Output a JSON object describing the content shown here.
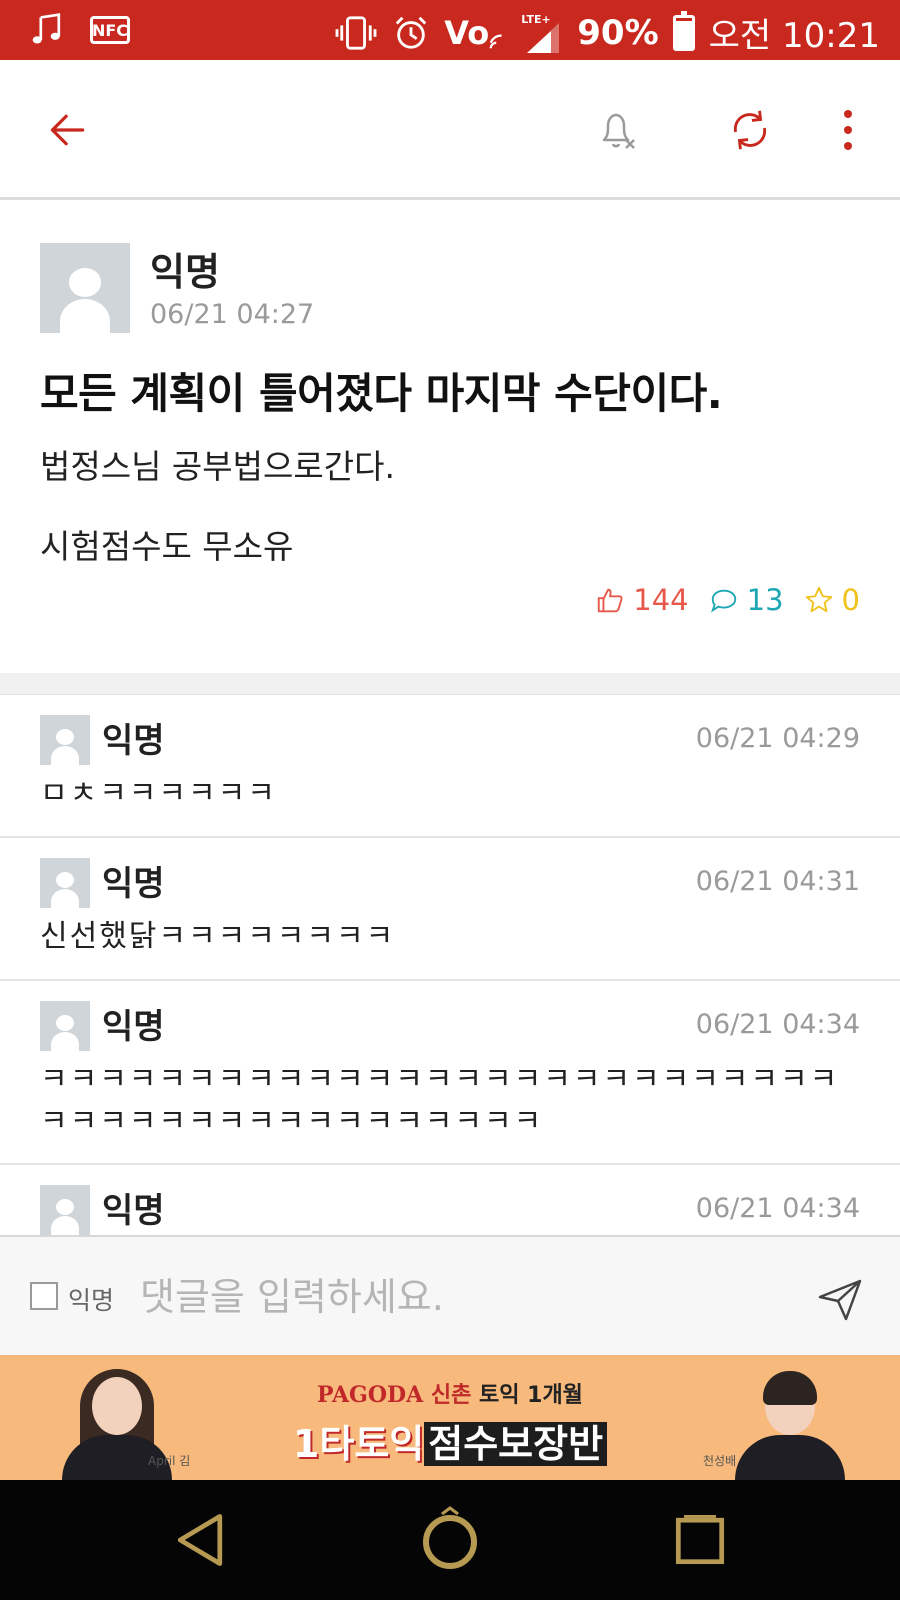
{
  "status_bar": {
    "battery_percent": "90%",
    "battery_level": 0.9,
    "time": "오전 10:21",
    "left_icons": [
      "music-note-icon",
      "nfc-icon"
    ],
    "right_icons": [
      "vibrate-icon",
      "alarm-icon",
      "volte-icon",
      "lte-signal-icon",
      "battery-icon"
    ],
    "nfc_label": "NFC",
    "volte_label": "Vo",
    "lte_label": "LTE+",
    "accent_color": "#c8281e"
  },
  "toolbar": {
    "icons": [
      "back-arrow-icon",
      "notification-off-icon",
      "refresh-icon",
      "more-vertical-icon"
    ]
  },
  "post": {
    "author": "익명",
    "time": "06/21 04:27",
    "title": "모든 계획이 틀어졌다 마지막 수단이다.",
    "body": [
      "법정스님 공부법으로간다.",
      "시험점수도 무소유"
    ],
    "likes": "144",
    "comments": "13",
    "scraps": "0",
    "colors": {
      "likes": "#e8584a",
      "comments": "#1fa7b4",
      "scraps": "#f1c21b"
    }
  },
  "comments": [
    {
      "author": "익명",
      "time": "06/21 04:29",
      "text": "ㅁㅊㅋㅋㅋㅋㅋㅋ"
    },
    {
      "author": "익명",
      "time": "06/21 04:31",
      "text": "신선했닭ㅋㅋㅋㅋㅋㅋㅋㅋ"
    },
    {
      "author": "익명",
      "time": "06/21 04:34",
      "text": "ㅋㅋㅋㅋㅋㅋㅋㅋㅋㅋㅋㅋㅋㅋㅋㅋㅋㅋㅋㅋㅋㅋㅋㅋㅋㅋㅋㅋㅋㅋㅋㅋㅋㅋㅋㅋㅋㅋㅋㅋㅋㅋㅋㅋ"
    },
    {
      "author": "익명",
      "time": "06/21 04:34",
      "text": ""
    }
  ],
  "input_bar": {
    "anonymous_label": "익명",
    "anonymous_checked": false,
    "placeholder": "댓글을 입력하세요."
  },
  "ad": {
    "brand": "PAGODA",
    "subtitle_location": "신촌",
    "subtitle_course": "토익 1개월",
    "headline_part1": "1타토익",
    "headline_part2": "점수보장반",
    "left_person": "April 김",
    "right_person": "천성배",
    "background_color": "#f8b97c"
  },
  "nav_bar": {
    "icons": [
      "nav-back-icon",
      "nav-home-icon",
      "nav-recents-icon"
    ]
  }
}
